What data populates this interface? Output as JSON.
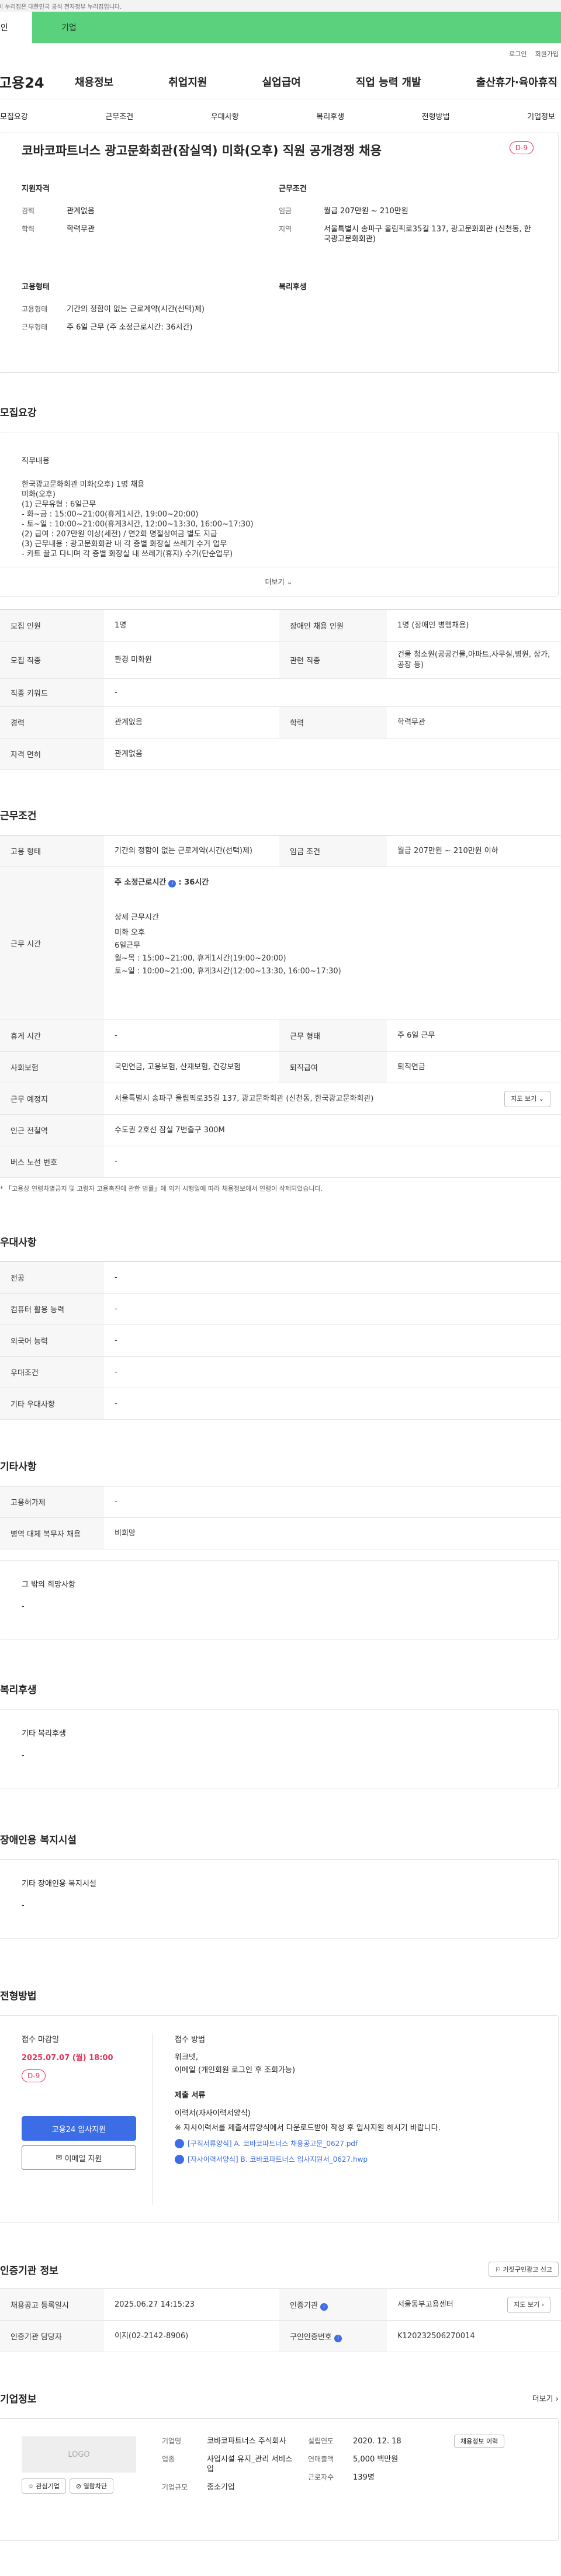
{
  "topbar": {
    "notice": "이 누리집은 대한민국 공식 전자정부 누리집입니다."
  },
  "tabs": {
    "person": "개인",
    "company": "기업"
  },
  "util": {
    "login": "로그인",
    "join": "회원가입"
  },
  "gnb": {
    "logo": "고용24",
    "menu": [
      "채용정보",
      "취업지원",
      "실업급여",
      "직업 능력 개발",
      "출산휴가·육아휴직"
    ]
  },
  "subnav": [
    "모집요강",
    "근무조건",
    "우대사항",
    "복리후생",
    "전형방법",
    "기업정보"
  ],
  "summary": {
    "title": "코바코파트너스 광고문화회관(잠실역) 미화(오후) 직원 공개경쟁 채용",
    "dday": "D-9",
    "qual_title": "지원자격",
    "qual": [
      {
        "k": "경력",
        "v": "관계없음"
      },
      {
        "k": "학력",
        "v": "학력무관"
      }
    ],
    "cond_title": "근무조건",
    "cond": [
      {
        "k": "임금",
        "v": "월급 207만원 ~ 210만원"
      },
      {
        "k": "지역",
        "v": "서울특별시 송파구 올림픽로35길 137, 광고문화회관 (신천동, 한국광고문화회관)"
      }
    ],
    "emp_title": "고용형태",
    "emp": [
      {
        "k": "고용형태",
        "v": "기간의 정함이 없는 근로계약(시간(선택)제)"
      },
      {
        "k": "근무형태",
        "v": "주 6일 근무 (주 소정근로시간: 36시간)"
      }
    ],
    "welfare_title": "복리후생"
  },
  "recruit": {
    "section": "모집요강",
    "duty_title": "직무내용",
    "duty_body": "한국광고문화회관 미화(오후) 1명 채용\n미화(오후)\n(1) 근무유형 : 6일근무\n  - 화~금 : 15:00~21:00(휴게1시간, 19:00~20:00)\n  - 토~일 : 10:00~21:00(휴게3시간, 12:00~13:30, 16:00~17:30)\n(2) 급여 : 207만원 이상(세전) / 연2회  명절상여금 별도 지급\n(3) 근무내용 : 광고문화회관 내 각 층별 화장실 쓰레기 수거 업무\n  - 카트 끌고 다니며 각 층별 화장실 내 쓰레기(휴지) 수거(단순업무)",
    "more": "더보기",
    "rows": [
      {
        "k1": "모집 인원",
        "v1": "1명",
        "k2": "장애인 채용 인원",
        "v2": "1명 (장애인 병행채용)"
      },
      {
        "k1": "모집 직종",
        "v1": "환경 미화원",
        "k2": "관련 직종",
        "v2": "건물 청소원(공공건물,아파트,사무실,병원, 상가,공장 등)"
      },
      {
        "k1": "직종 키워드",
        "v1": "-"
      },
      {
        "k1": "경력",
        "v1": "관계없음",
        "k2": "학력",
        "v2": "학력무관"
      },
      {
        "k1": "자격 면허",
        "v1": "관계없음"
      }
    ]
  },
  "work": {
    "section": "근무조건",
    "emp_k": "고용 형태",
    "emp_v": "기간의 정함이 없는 근로계약(시간(선택)제)",
    "wage_k": "임금 조건",
    "wage_v": "월급 207만원 ~ 210만원 이하",
    "hours_k": "근무 시간",
    "hours_main": "주 소정근로시간",
    "hours_val": ": 36시간",
    "hours_detail_t": "상세 근무시간",
    "hours_detail": "미화 오후\n6일근무\n월~목 : 15:00~21:00, 휴게1시간(19:00~20:00)\n토~일 : 10:00~21:00, 휴게3시간(12:00~13:30, 16:00~17:30)",
    "rest_k": "휴게 시간",
    "rest_v": "-",
    "form_k": "근무 형태",
    "form_v": "주 6일 근무",
    "ins_k": "사회보험",
    "ins_v": "국민연금, 고용보험, 산재보험, 건강보험",
    "ret_k": "퇴직급여",
    "ret_v": "퇴직연금",
    "place_k": "근무 예정지",
    "place_v": "서울특별시 송파구 올림픽로35길 137, 광고문화회관 (신천동, 한국광고문화회관)",
    "map_btn": "지도 보기",
    "subway_k": "인근 전철역",
    "subway_v": "수도권 2호선 잠실 7번출구 300M",
    "bus_k": "버스 노선 번호",
    "bus_v": "-",
    "note": "* 「고용상 연령차별금지 및 고령자 고용촉진에 관한 법률」에 의거 시행일에 따라 채용정보에서 연령이 삭제되었습니다."
  },
  "pref": {
    "section": "우대사항",
    "rows": [
      {
        "k": "전공",
        "v": "-"
      },
      {
        "k": "컴퓨터 활용 능력",
        "v": "-"
      },
      {
        "k": "외국어 능력",
        "v": "-"
      },
      {
        "k": "우대조건",
        "v": "-"
      },
      {
        "k": "기타 우대사항",
        "v": "-"
      }
    ]
  },
  "etc": {
    "section": "기타사항",
    "rows": [
      {
        "k": "고용허가제",
        "v": "-"
      },
      {
        "k": "병역 대체 복무자 채용",
        "v": "비희망"
      }
    ],
    "hope_t": "그 밖의 희망사항",
    "hope_v": "-"
  },
  "welfare": {
    "section": "복리후생",
    "t": "기타 복리후생",
    "v": "-"
  },
  "disabled": {
    "section": "장애인용 복지시설",
    "t": "기타 장애인용 복지시설",
    "v": "-"
  },
  "apply": {
    "section": "전형방법",
    "deadline_t": "접수 마감일",
    "deadline_v": "2025.07.07 (월) 18:00",
    "dday": "D-9",
    "btn_apply": "고용24 입사지원",
    "btn_email": "이메일 지원",
    "method_t": "접수 방법",
    "method_v": "워크넷,\n이메일 (개인회원 로그인 후 조회가능)",
    "doc_t": "제출 서류",
    "doc_v": "이력서(자사이력서양식)",
    "doc_note": "※ 자사이력서를 제출서류양식에서 다운로드받아 작성 후 입사지원 하시기 바랍니다.",
    "files": [
      "[구직서류양식] A. 코바코파트너스 채용공고문_0627.pdf",
      "[자사이력서양식] B. 코바코파트너스 입사지원서_0627.hwp"
    ]
  },
  "cert": {
    "section": "인증기관 정보",
    "report_btn": "거짓구인광고 신고",
    "reg_k": "채용공고 등록일시",
    "reg_v": "2025.06.27 14:15:23",
    "org_k": "인증기관",
    "org_v": "서울동부고용센터",
    "map_btn": "지도 보기",
    "mgr_k": "인증기관 담당자",
    "mgr_v": "이지(02-2142-8906)",
    "no_k": "구인인증번호",
    "no_v": "K120232506270014"
  },
  "company": {
    "section": "기업정보",
    "more": "더보기",
    "logo": "LOGO",
    "fav_btn": "관심기업",
    "block_btn": "열람차단",
    "name_k": "기업명",
    "name_v": "코바코파트너스 주식회사",
    "ind_k": "업종",
    "ind_v": "사업시설 유지_관리 서비스업",
    "size_k": "기업규모",
    "size_v": "중소기업",
    "est_k": "설립연도",
    "est_v": "2020. 12. 18",
    "sales_k": "연매출액",
    "sales_v": "5,000 백만원",
    "emp_k": "근로자수",
    "emp_v": "139명",
    "hist_btn": "채용정보 이력"
  }
}
